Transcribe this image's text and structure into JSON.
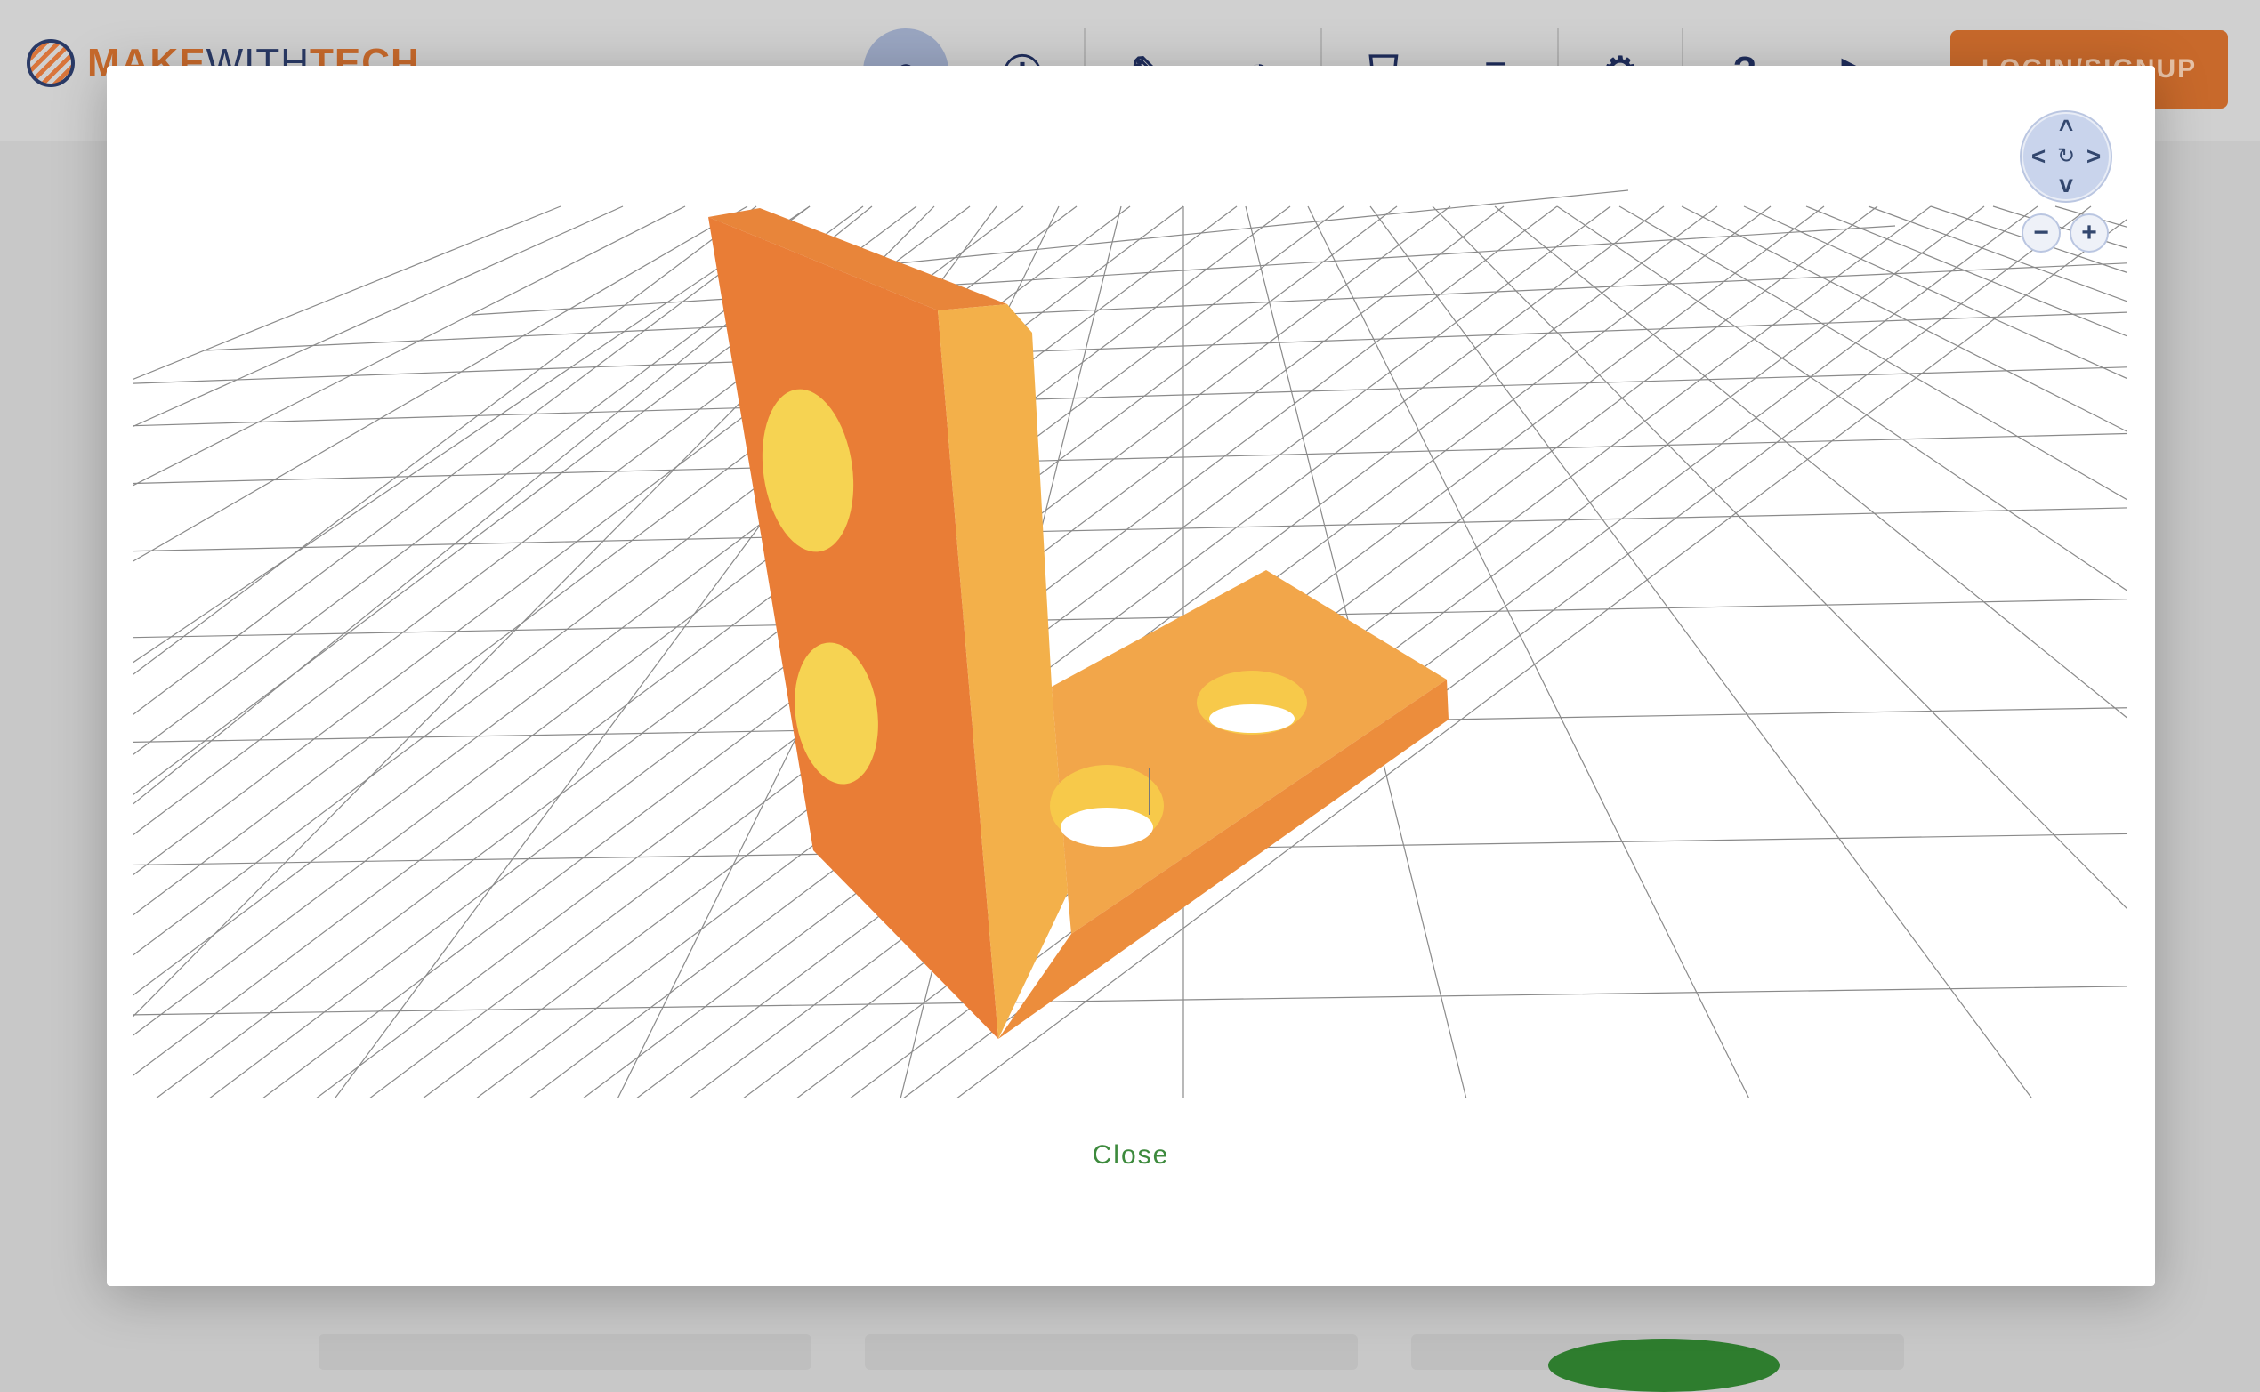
{
  "header": {
    "logo": {
      "make": "MAKE",
      "with": "WITH",
      "tech": "TECH"
    },
    "nav_icons": [
      {
        "name": "home-icon",
        "glyph": "●",
        "active": true
      },
      {
        "name": "info-circle-icon",
        "glyph": "Ⓘ"
      },
      {
        "name": "pencil-icon",
        "glyph": "✎"
      },
      {
        "name": "gauge-icon",
        "glyph": "◔"
      },
      {
        "name": "shield-icon",
        "glyph": "⛉"
      },
      {
        "name": "menu-icon",
        "glyph": "≡"
      },
      {
        "name": "settings-icon",
        "glyph": "⚙"
      },
      {
        "name": "help-icon",
        "glyph": "?"
      },
      {
        "name": "video-icon",
        "glyph": "▶"
      },
      {
        "name": "about-icon",
        "glyph": "ℹ"
      }
    ],
    "login_label": "LOGIN/SIGNUP"
  },
  "viewer": {
    "controls": {
      "up": "^",
      "down": "v",
      "left": "<",
      "right": ">",
      "reset": "↻",
      "zoom_out": "−",
      "zoom_in": "+"
    },
    "model_colors": {
      "light": "#f5b64a",
      "mid": "#f09a44",
      "dark": "#e77a34",
      "hole": "#fbe766"
    }
  },
  "modal": {
    "close_label": "Close"
  },
  "colors": {
    "accent": "#c8692b",
    "navy": "#1f2d5c",
    "close_green": "#3d8a3d"
  }
}
